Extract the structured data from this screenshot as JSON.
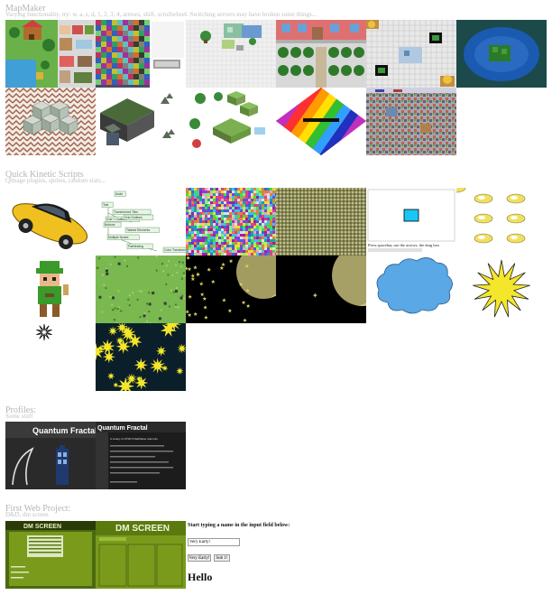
{
  "sections": {
    "mapmaker": {
      "title": "MapMaker",
      "subtitle": "Varying functionality, try: w, a, s, d, 1, 2, 3, 4, arrows, shift, scrollwheel. Switching servers may have broken some things..."
    },
    "kinetic": {
      "title": "Quick Kinetic Scripts",
      "subtitle": "Qimage plugins, sprites, random stars..."
    },
    "profiles": {
      "title": "Profiles:",
      "subtitle": "Some stuff"
    },
    "webproject": {
      "title": "First Web Project:",
      "subtitle": "D&D, dm screen"
    }
  },
  "profile_thumbs": [
    {
      "heading": "Quantum Fractal"
    },
    {
      "heading": "Quantum Fractal",
      "body": "A variety of HTML5 MapMaker attempts"
    }
  ],
  "kinetic_tree_labels": [
    "Node",
    "Test",
    "Transformed Tiles",
    "Grid + Outlines",
    "Grid Outlines",
    "Buttons",
    "Tabbed Elements",
    "Multiple Nodes",
    "Pathfinding",
    "Color Transform"
  ],
  "kinetic_canvas_caption": "Press spacebar, use the arrows, the drag box",
  "dm_screen": {
    "title": "DM SCREEN",
    "prompt": "Start typing a name in the input field below:",
    "input_value": "Very Early!",
    "button1": "Very Early!",
    "button2": "Sub 1!",
    "greeting": "Hello"
  },
  "colors": {
    "dm_green": "#7a9a1c",
    "night_bg": "#0a1f2a",
    "star_yellow": "#f4e62a",
    "cloud_blue": "#5aa8e6"
  }
}
